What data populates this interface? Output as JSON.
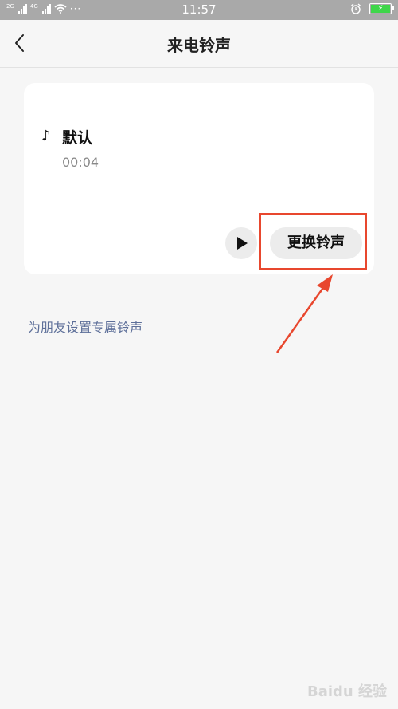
{
  "status_bar": {
    "network_1": "2G",
    "network_2": "4G",
    "dots": "···",
    "time": "11:57",
    "battery_icon": "⚡"
  },
  "nav": {
    "title": "来电铃声"
  },
  "ringtone": {
    "note_icon": "♪",
    "name": "默认",
    "duration": "00:04",
    "change_label": "更换铃声"
  },
  "friend_link": "为朋友设置专属铃声",
  "watermark": "Baidu 经验",
  "colors": {
    "accent_link": "#5d6f99",
    "highlight": "#e8472e",
    "battery": "#3fd64a"
  }
}
